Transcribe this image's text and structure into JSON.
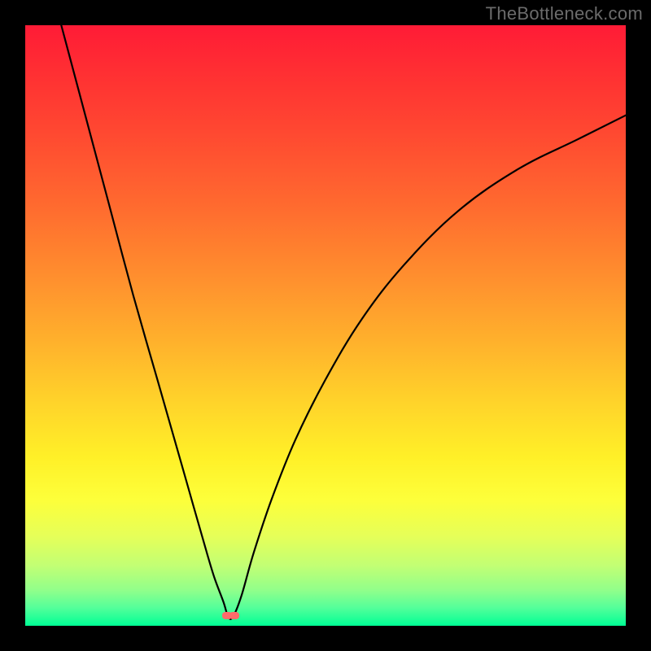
{
  "watermark": {
    "text": "TheBottleneck.com"
  },
  "chart_data": {
    "type": "line",
    "title": "",
    "xlabel": "",
    "ylabel": "",
    "xlim": [
      0,
      100
    ],
    "ylim": [
      0,
      100
    ],
    "grid": false,
    "legend": false,
    "series": [
      {
        "name": "curve",
        "color": "#000000",
        "x": [
          6,
          10,
          14,
          18,
          22,
          26,
          28,
          30,
          31.5,
          33,
          33.8,
          34.6,
          36,
          38,
          41,
          45,
          50,
          56,
          63,
          72,
          82,
          92,
          100
        ],
        "y": [
          100,
          85,
          70,
          55,
          41,
          27,
          20,
          13,
          8,
          4,
          1.5,
          1.5,
          5,
          12,
          21,
          31,
          41,
          51,
          60,
          69,
          76,
          81,
          85
        ]
      }
    ],
    "markers": [
      {
        "name": "min-marker-a",
        "x": 33.4,
        "y": 1.4,
        "color": "#ff6a6a"
      },
      {
        "name": "min-marker-b",
        "x": 34.6,
        "y": 1.4,
        "color": "#ff6a6a"
      }
    ],
    "background": {
      "type": "vertical-gradient",
      "stops": [
        {
          "pos": 0.0,
          "color": "#ff1b36"
        },
        {
          "pos": 0.5,
          "color": "#ffb22c"
        },
        {
          "pos": 0.78,
          "color": "#fdff3a"
        },
        {
          "pos": 1.0,
          "color": "#00ff95"
        }
      ]
    }
  }
}
